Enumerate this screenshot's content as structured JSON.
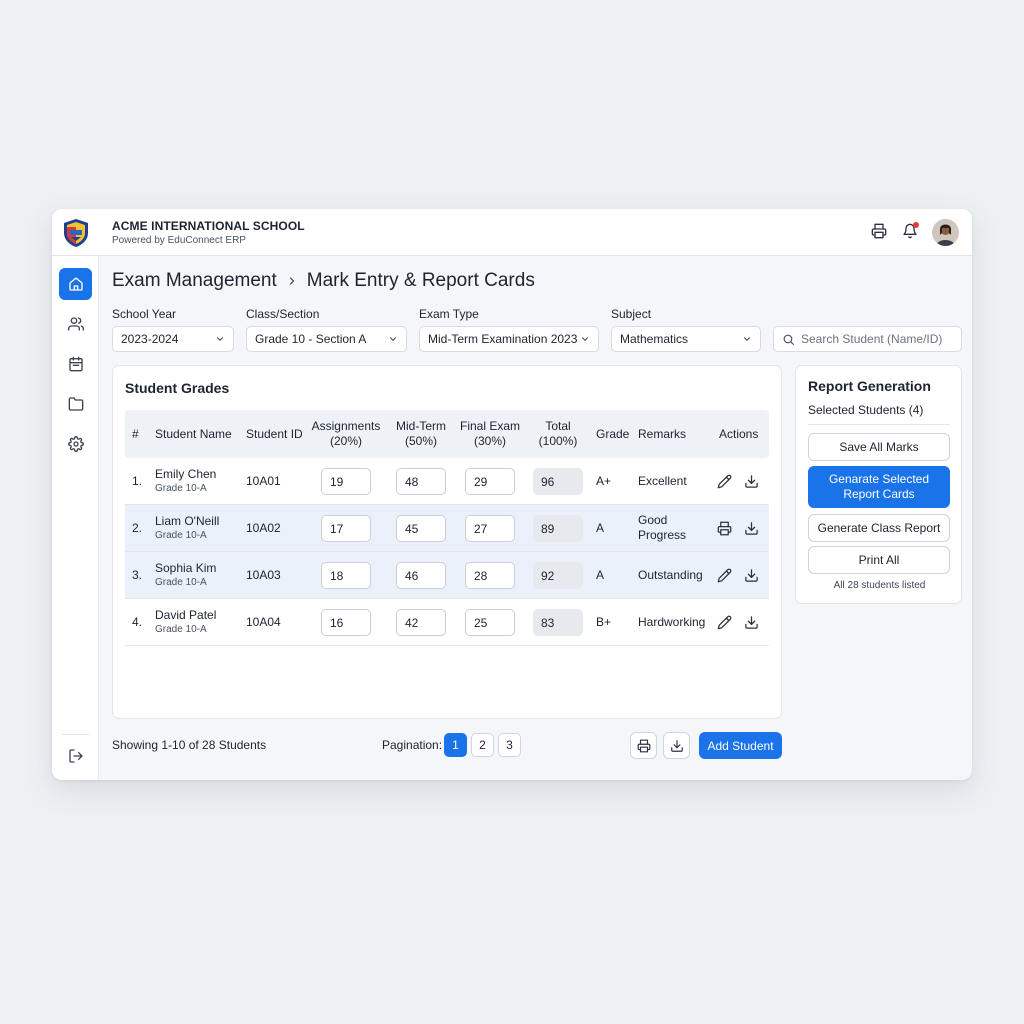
{
  "app": {
    "school_name": "ACME INTERNATIONAL SCHOOL",
    "powered_by": "Powered by EduConnect ERP"
  },
  "topbar": {
    "icons": [
      "printer-icon",
      "bell-icon"
    ],
    "notification_dot_color": "#e53935"
  },
  "sidebar": {
    "items": [
      {
        "icon": "home-icon",
        "active": true
      },
      {
        "icon": "users-icon",
        "active": false
      },
      {
        "icon": "calendar-icon",
        "active": false
      },
      {
        "icon": "folder-icon",
        "active": false
      },
      {
        "icon": "gear-icon",
        "active": false
      }
    ],
    "bottom_icon": "logout-icon"
  },
  "breadcrumb": {
    "parent": "Exam Management",
    "current": "Mark Entry & Report Cards"
  },
  "filters": {
    "school_year": {
      "label": "School Year",
      "value": "2023-2024"
    },
    "class_section": {
      "label": "Class/Section",
      "value": "Grade 10 - Section A"
    },
    "exam_type": {
      "label": "Exam Type",
      "value": "Mid-Term Examination 2023"
    },
    "subject": {
      "label": "Subject",
      "value": "Mathematics"
    },
    "search_placeholder": "Search Student (Name/ID)"
  },
  "grades": {
    "title": "Student Grades",
    "headers": {
      "num": "#",
      "name": "Student Name",
      "id": "Student ID",
      "assignments": "Assignments",
      "assignments_weight": "(20%)",
      "midterm": "Mid-Term",
      "midterm_weight": "(50%)",
      "final": "Final Exam",
      "final_weight": "(30%)",
      "total": "Total",
      "total_weight": "(100%)",
      "grade": "Grade",
      "remarks": "Remarks",
      "actions": "Actions"
    },
    "rows": [
      {
        "num": "1.",
        "name": "Emily Chen",
        "section": "Grade 10-A",
        "id": "10A01",
        "assignments": "19",
        "midterm": "48",
        "final": "29",
        "total": "96",
        "grade": "A+",
        "remarks": "Excellent",
        "icons": [
          "pencil-icon",
          "download-icon"
        ]
      },
      {
        "num": "2.",
        "name": "Liam O'Neill",
        "section": "Grade 10-A",
        "id": "10A02",
        "assignments": "17",
        "midterm": "45",
        "final": "27",
        "total": "89",
        "grade": "A",
        "remarks": "Good Progress",
        "icons": [
          "printer-icon",
          "download-icon"
        ]
      },
      {
        "num": "3.",
        "name": "Sophia Kim",
        "section": "Grade 10-A",
        "id": "10A03",
        "assignments": "18",
        "midterm": "46",
        "final": "28",
        "total": "92",
        "grade": "A",
        "remarks": "Outstanding",
        "icons": [
          "pencil-icon",
          "download-icon"
        ]
      },
      {
        "num": "4.",
        "name": "David Patel",
        "section": "Grade 10-A",
        "id": "10A04",
        "assignments": "16",
        "midterm": "42",
        "final": "25",
        "total": "83",
        "grade": "B+",
        "remarks": "Hardworking",
        "icons": [
          "pencil-icon",
          "download-icon"
        ]
      }
    ]
  },
  "report": {
    "title": "Report Generation",
    "selected": "Selected Students (4)",
    "save_all": "Save All Marks",
    "generate_selected": "Genarate Selected Report Cards",
    "generate_class": "Generate Class Report",
    "print_all": "Print All",
    "note": "All 28 students listed"
  },
  "footer": {
    "showing": "Showing 1-10 of 28 Students",
    "pagination_label": "Pagination:",
    "pages": [
      "1",
      "2",
      "3"
    ],
    "current_page": "1",
    "add_student": "Add Student"
  },
  "colors": {
    "accent": "#1a73e8",
    "row_highlight": "#eaf1fb",
    "page_bg": "#eef1f4"
  }
}
